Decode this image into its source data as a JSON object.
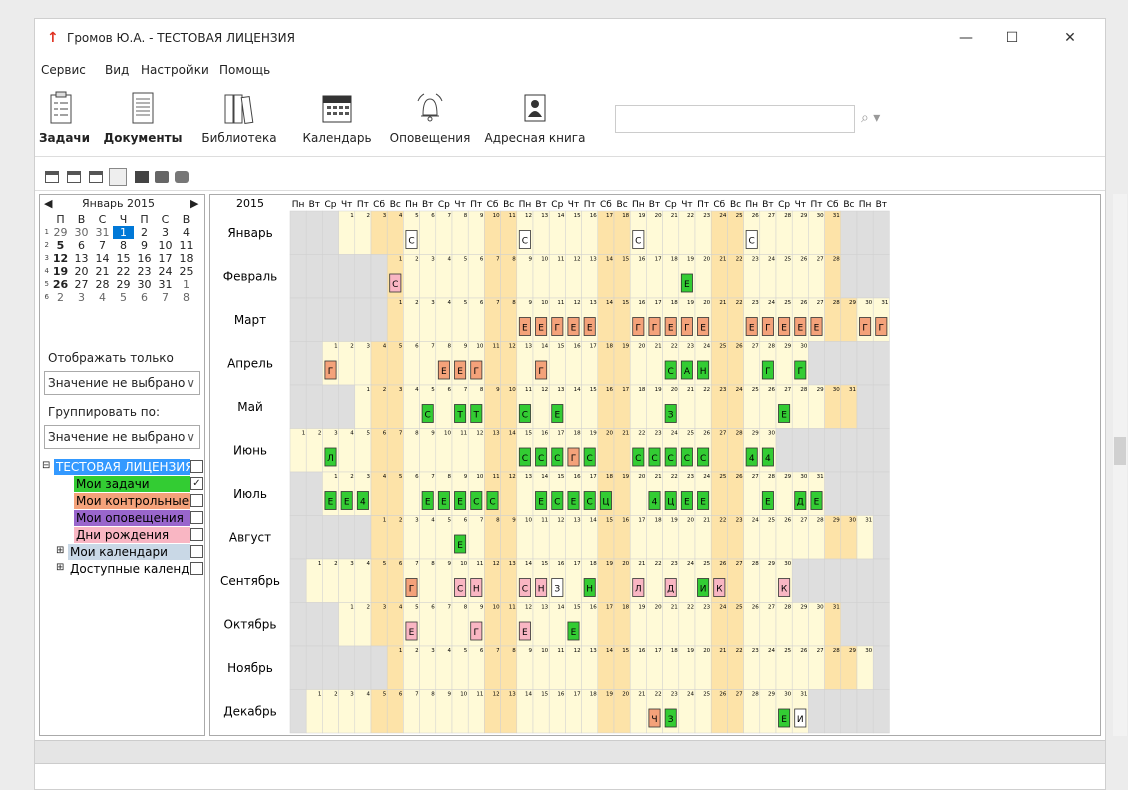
{
  "window": {
    "title": "Громов Ю.А. - ТЕСТОВАЯ ЛИЦЕНЗИЯ",
    "minimize": "—",
    "maximize": "☐",
    "close": "✕",
    "app_icon": "↑"
  },
  "menu": [
    "Сервис",
    "Вид",
    "Настройки",
    "Помощь"
  ],
  "ribbon": [
    {
      "label": "Задачи",
      "icon": "tasks-icon",
      "bold": true
    },
    {
      "label": "Документы",
      "icon": "documents-icon",
      "bold": true
    },
    {
      "label": "Библиотека",
      "icon": "library-icon",
      "bold": false
    },
    {
      "label": "Календарь",
      "icon": "calendar-icon",
      "bold": false
    },
    {
      "label": "Оповещения",
      "icon": "bell-icon",
      "bold": false
    },
    {
      "label": "Адресная книга",
      "icon": "address-book-icon",
      "bold": false
    }
  ],
  "search": {
    "value": "",
    "placeholder": "",
    "icon": "search-icon"
  },
  "mini_calendar": {
    "title": "Январь 2015",
    "prev": "◀",
    "next": "▶",
    "weekdays": [
      "П",
      "В",
      "С",
      "Ч",
      "П",
      "С",
      "В"
    ],
    "weeks": [
      {
        "wk": "1",
        "days": [
          "29",
          "30",
          "31",
          "1",
          "2",
          "3",
          "4"
        ]
      },
      {
        "wk": "2",
        "days": [
          "5",
          "6",
          "7",
          "8",
          "9",
          "10",
          "11"
        ]
      },
      {
        "wk": "3",
        "days": [
          "12",
          "13",
          "14",
          "15",
          "16",
          "17",
          "18"
        ]
      },
      {
        "wk": "4",
        "days": [
          "19",
          "20",
          "21",
          "22",
          "23",
          "24",
          "25"
        ]
      },
      {
        "wk": "5",
        "days": [
          "26",
          "27",
          "28",
          "29",
          "30",
          "31",
          "1"
        ]
      },
      {
        "wk": "6",
        "days": [
          "2",
          "3",
          "4",
          "5",
          "6",
          "7",
          "8"
        ]
      }
    ]
  },
  "filter": {
    "show_only_label": "Отображать только",
    "show_only_value": "Значение не выбрано",
    "group_label": "Группировать по:",
    "group_value": "Значение не выбрано"
  },
  "tree": [
    {
      "label": "ТЕСТОВАЯ ЛИЦЕНЗИЯ",
      "bg": "#3399ff",
      "fg": "#ffffff",
      "checked": false,
      "expander": "⊟",
      "level": 0
    },
    {
      "label": "Мои задачи",
      "bg": "#33cc33",
      "fg": "#000000",
      "checked": true,
      "level": 1
    },
    {
      "label": "Мои контрольные",
      "bg": "#f4a27a",
      "fg": "#000000",
      "checked": false,
      "level": 1
    },
    {
      "label": "Мои оповещения",
      "bg": "#9966cc",
      "fg": "#000000",
      "checked": false,
      "level": 1
    },
    {
      "label": "Дни рождения",
      "bg": "#f9b6c3",
      "fg": "#000000",
      "checked": false,
      "level": 1
    },
    {
      "label": "Мои календари",
      "bg": "#c9d8e6",
      "fg": "#000000",
      "checked": false,
      "expander": "⊞",
      "level": 1
    },
    {
      "label": "Доступные календари",
      "bg": "#ffffff",
      "fg": "#000000",
      "checked": false,
      "expander": "⊞",
      "level": 1
    }
  ],
  "grid": {
    "year": "2015",
    "weekday_headers": [
      "Пн",
      "Вт",
      "Ср",
      "Чт",
      "Пт",
      "Сб",
      "Вс",
      "Пн",
      "Вт",
      "Ср",
      "Чт",
      "Пт",
      "Сб",
      "Вс",
      "Пн",
      "Вт",
      "Ср",
      "Чт",
      "Пт",
      "Сб",
      "Вс",
      "Пн",
      "Вт",
      "Ср",
      "Чт",
      "Пт",
      "Сб",
      "Вс",
      "Пн",
      "Вт",
      "Ср",
      "Чт",
      "Пт",
      "Сб",
      "Вс",
      "Пн",
      "Вт"
    ],
    "months": [
      {
        "name": "Январь",
        "start": 3,
        "days": 31
      },
      {
        "name": "Февраль",
        "start": 6,
        "days": 28
      },
      {
        "name": "Март",
        "start": 6,
        "days": 31
      },
      {
        "name": "Апрель",
        "start": 2,
        "days": 30
      },
      {
        "name": "Май",
        "start": 4,
        "days": 31
      },
      {
        "name": "Июнь",
        "start": 0,
        "days": 30
      },
      {
        "name": "Июль",
        "start": 2,
        "days": 31
      },
      {
        "name": "Август",
        "start": 5,
        "days": 31
      },
      {
        "name": "Сентябрь",
        "start": 1,
        "days": 30
      },
      {
        "name": "Октябрь",
        "start": 3,
        "days": 31
      },
      {
        "name": "Ноябрь",
        "start": 6,
        "days": 30
      },
      {
        "name": "Декабрь",
        "start": 1,
        "days": 31
      }
    ],
    "events": [
      {
        "m": 0,
        "d": 5,
        "c": "w",
        "t": "С"
      },
      {
        "m": 0,
        "d": 12,
        "c": "w",
        "t": "С"
      },
      {
        "m": 0,
        "d": 19,
        "c": "w",
        "t": "С"
      },
      {
        "m": 0,
        "d": 26,
        "c": "w",
        "t": "С"
      },
      {
        "m": 1,
        "d": 1,
        "c": "p",
        "t": "С"
      },
      {
        "m": 1,
        "d": 19,
        "c": "g",
        "t": "Е"
      },
      {
        "m": 2,
        "d": 9,
        "c": "o",
        "t": "Е"
      },
      {
        "m": 2,
        "d": 10,
        "c": "o",
        "t": "Е"
      },
      {
        "m": 2,
        "d": 11,
        "c": "o",
        "t": "Г"
      },
      {
        "m": 2,
        "d": 12,
        "c": "o",
        "t": "Е"
      },
      {
        "m": 2,
        "d": 13,
        "c": "o",
        "t": "Е"
      },
      {
        "m": 2,
        "d": 16,
        "c": "o",
        "t": "Г"
      },
      {
        "m": 2,
        "d": 17,
        "c": "o",
        "t": "Г"
      },
      {
        "m": 2,
        "d": 18,
        "c": "o",
        "t": "Е"
      },
      {
        "m": 2,
        "d": 19,
        "c": "o",
        "t": "Г"
      },
      {
        "m": 2,
        "d": 20,
        "c": "o",
        "t": "Е"
      },
      {
        "m": 2,
        "d": 23,
        "c": "o",
        "t": "Е"
      },
      {
        "m": 2,
        "d": 24,
        "c": "o",
        "t": "Г"
      },
      {
        "m": 2,
        "d": 25,
        "c": "o",
        "t": "Е"
      },
      {
        "m": 2,
        "d": 26,
        "c": "o",
        "t": "Е"
      },
      {
        "m": 2,
        "d": 27,
        "c": "o",
        "t": "Е"
      },
      {
        "m": 2,
        "d": 30,
        "c": "o",
        "t": "Г"
      },
      {
        "m": 2,
        "d": 31,
        "c": "o",
        "t": "Г"
      },
      {
        "m": 3,
        "d": 1,
        "c": "o",
        "t": "Г"
      },
      {
        "m": 3,
        "d": 8,
        "c": "o",
        "t": "Е"
      },
      {
        "m": 3,
        "d": 9,
        "c": "o",
        "t": "Е"
      },
      {
        "m": 3,
        "d": 10,
        "c": "o",
        "t": "Г"
      },
      {
        "m": 3,
        "d": 14,
        "c": "o",
        "t": "Г"
      },
      {
        "m": 3,
        "d": 22,
        "c": "g",
        "t": "С"
      },
      {
        "m": 3,
        "d": 23,
        "c": "g",
        "t": "А"
      },
      {
        "m": 3,
        "d": 24,
        "c": "g",
        "t": "Н"
      },
      {
        "m": 3,
        "d": 28,
        "c": "g",
        "t": "Г"
      },
      {
        "m": 3,
        "d": 30,
        "c": "g",
        "t": "Г"
      },
      {
        "m": 4,
        "d": 5,
        "c": "g",
        "t": "С"
      },
      {
        "m": 4,
        "d": 7,
        "c": "g",
        "t": "Т"
      },
      {
        "m": 4,
        "d": 8,
        "c": "g",
        "t": "Т"
      },
      {
        "m": 4,
        "d": 11,
        "c": "g",
        "t": "С"
      },
      {
        "m": 4,
        "d": 13,
        "c": "g",
        "t": "Е"
      },
      {
        "m": 4,
        "d": 20,
        "c": "g",
        "t": "З"
      },
      {
        "m": 4,
        "d": 27,
        "c": "g",
        "t": "Е"
      },
      {
        "m": 5,
        "d": 3,
        "c": "g",
        "t": "Л"
      },
      {
        "m": 5,
        "d": 15,
        "c": "g",
        "t": "С"
      },
      {
        "m": 5,
        "d": 16,
        "c": "g",
        "t": "С"
      },
      {
        "m": 5,
        "d": 17,
        "c": "g",
        "t": "С"
      },
      {
        "m": 5,
        "d": 18,
        "c": "o",
        "t": "Г"
      },
      {
        "m": 5,
        "d": 19,
        "c": "g",
        "t": "С"
      },
      {
        "m": 5,
        "d": 22,
        "c": "g",
        "t": "С"
      },
      {
        "m": 5,
        "d": 23,
        "c": "g",
        "t": "С"
      },
      {
        "m": 5,
        "d": 24,
        "c": "g",
        "t": "С"
      },
      {
        "m": 5,
        "d": 25,
        "c": "g",
        "t": "С"
      },
      {
        "m": 5,
        "d": 26,
        "c": "g",
        "t": "С"
      },
      {
        "m": 5,
        "d": 29,
        "c": "g",
        "t": "4"
      },
      {
        "m": 5,
        "d": 30,
        "c": "g",
        "t": "4"
      },
      {
        "m": 6,
        "d": 1,
        "c": "g",
        "t": "Е"
      },
      {
        "m": 6,
        "d": 2,
        "c": "g",
        "t": "Е"
      },
      {
        "m": 6,
        "d": 3,
        "c": "g",
        "t": "4"
      },
      {
        "m": 6,
        "d": 7,
        "c": "g",
        "t": "Е"
      },
      {
        "m": 6,
        "d": 8,
        "c": "g",
        "t": "Е"
      },
      {
        "m": 6,
        "d": 9,
        "c": "g",
        "t": "Е"
      },
      {
        "m": 6,
        "d": 10,
        "c": "g",
        "t": "С"
      },
      {
        "m": 6,
        "d": 11,
        "c": "g",
        "t": "С"
      },
      {
        "m": 6,
        "d": 14,
        "c": "g",
        "t": "Е"
      },
      {
        "m": 6,
        "d": 15,
        "c": "g",
        "t": "С"
      },
      {
        "m": 6,
        "d": 16,
        "c": "g",
        "t": "Е"
      },
      {
        "m": 6,
        "d": 17,
        "c": "g",
        "t": "С"
      },
      {
        "m": 6,
        "d": 18,
        "c": "g",
        "t": "Ц"
      },
      {
        "m": 6,
        "d": 21,
        "c": "g",
        "t": "4"
      },
      {
        "m": 6,
        "d": 22,
        "c": "g",
        "t": "Ц"
      },
      {
        "m": 6,
        "d": 23,
        "c": "g",
        "t": "Е"
      },
      {
        "m": 6,
        "d": 24,
        "c": "g",
        "t": "Е"
      },
      {
        "m": 6,
        "d": 28,
        "c": "g",
        "t": "Е"
      },
      {
        "m": 6,
        "d": 30,
        "c": "g",
        "t": "Д"
      },
      {
        "m": 6,
        "d": 31,
        "c": "g",
        "t": "Е"
      },
      {
        "m": 7,
        "d": 6,
        "c": "g",
        "t": "Е"
      },
      {
        "m": 8,
        "d": 7,
        "c": "o",
        "t": "Г"
      },
      {
        "m": 8,
        "d": 10,
        "c": "p",
        "t": "С"
      },
      {
        "m": 8,
        "d": 11,
        "c": "p",
        "t": "Н"
      },
      {
        "m": 8,
        "d": 14,
        "c": "p",
        "t": "С"
      },
      {
        "m": 8,
        "d": 15,
        "c": "p",
        "t": "Н"
      },
      {
        "m": 8,
        "d": 16,
        "c": "w",
        "t": "З"
      },
      {
        "m": 8,
        "d": 18,
        "c": "g",
        "t": "Н"
      },
      {
        "m": 8,
        "d": 21,
        "c": "p",
        "t": "Л"
      },
      {
        "m": 8,
        "d": 23,
        "c": "p",
        "t": "Д"
      },
      {
        "m": 8,
        "d": 25,
        "c": "g",
        "t": "И"
      },
      {
        "m": 8,
        "d": 26,
        "c": "p",
        "t": "К"
      },
      {
        "m": 8,
        "d": 30,
        "c": "p",
        "t": "К"
      },
      {
        "m": 9,
        "d": 5,
        "c": "p",
        "t": "Е"
      },
      {
        "m": 9,
        "d": 9,
        "c": "p",
        "t": "Г"
      },
      {
        "m": 9,
        "d": 12,
        "c": "p",
        "t": "Е"
      },
      {
        "m": 9,
        "d": 15,
        "c": "g",
        "t": "Е"
      },
      {
        "m": 11,
        "d": 22,
        "c": "o",
        "t": "Ч"
      },
      {
        "m": 11,
        "d": 23,
        "c": "g",
        "t": "З"
      },
      {
        "m": 11,
        "d": 30,
        "c": "g",
        "t": "Е"
      },
      {
        "m": 11,
        "d": 31,
        "c": "w",
        "t": "И"
      }
    ]
  },
  "colors": {
    "g": "#33cc33",
    "o": "#f4a27a",
    "p": "#f9b6c3",
    "w": "#ffffff",
    "weekday": "#fffad7",
    "weekend": "#fde3a8",
    "empty": "#dedede",
    "today": "#0078d7"
  }
}
